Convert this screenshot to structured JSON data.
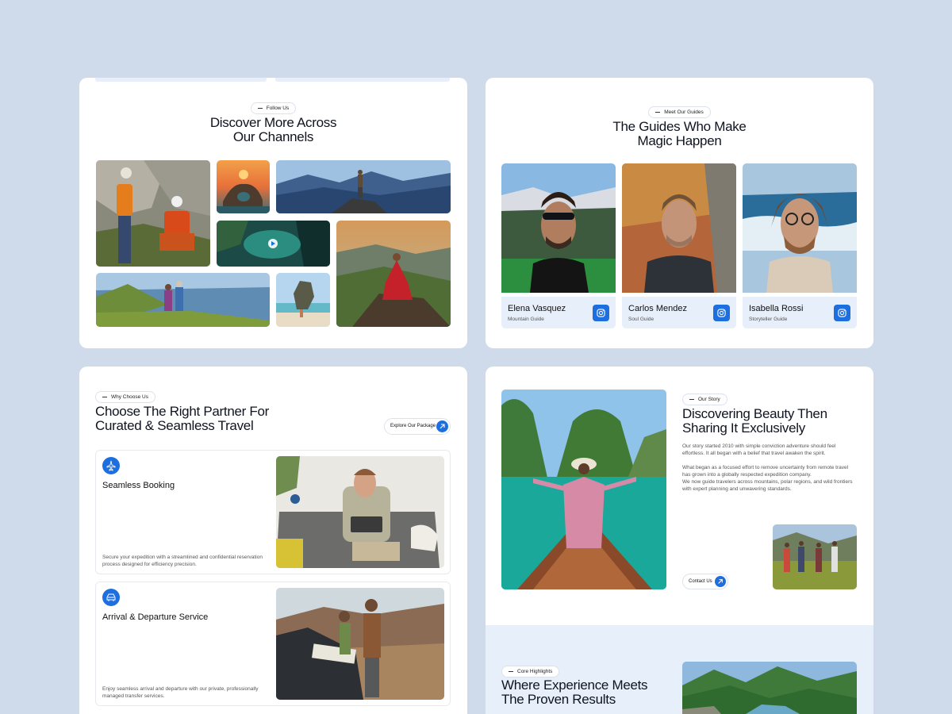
{
  "follow_section": {
    "pill": "Follow Us",
    "title_line1": "Discover More Across",
    "title_line2": "Our Channels"
  },
  "guides_section": {
    "pill": "Meet Our Guides",
    "title_line1": "The Guides Who Make",
    "title_line2": "Magic Happen",
    "guides": [
      {
        "name": "Elena Vasquez",
        "role": "Mountain Guide"
      },
      {
        "name": "Carlos Mendez",
        "role": "Soul Guide"
      },
      {
        "name": "Isabella Rossi",
        "role": "Storyteller Guide"
      }
    ]
  },
  "why_section": {
    "pill": "Why Choose Us",
    "title_line1": "Choose The Right Partner For",
    "title_line2": "Curated & Seamless Travel",
    "explore_button": "Explore Our Package",
    "features": [
      {
        "title": "Seamless Booking",
        "desc": "Secure your expedition with a streamlined and confidential reservation process designed for efficiency precision.",
        "icon": "plane-icon"
      },
      {
        "title": "Arrival & Departure Service",
        "desc": "Enjoy seamless arrival and departure with our private, professionally managed transfer services.",
        "icon": "car-icon"
      }
    ]
  },
  "story_section": {
    "pill": "Our Story",
    "title_line1": "Discovering Beauty Then",
    "title_line2": "Sharing It Exclusively",
    "para1": "Our story started 2010 with simple conviction adventure should feel effortless. It all began with a belief that travel awaken the spirit.",
    "para2a": "What began as a focused effort to remove uncertainty from remote travel has grown into a globally respected expedition company.",
    "para2b": "We now guide travelers across mountains, polar regions, and wild frontiers with expert planning and unwavering standards.",
    "contact_button": "Contact Us"
  },
  "highlights_section": {
    "pill": "Core Highlights",
    "title_line1": "Where Experience Meets",
    "title_line2": "The Proven Results"
  },
  "colors": {
    "background": "#cfdbea",
    "accent": "#1d6fe0",
    "guide_card": "#e7effb"
  }
}
